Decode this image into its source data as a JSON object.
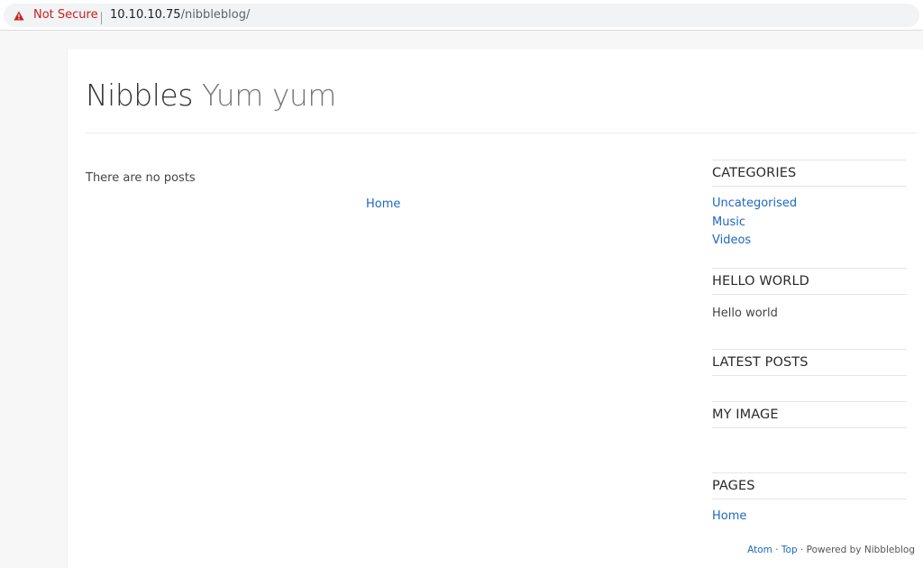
{
  "browser": {
    "security_label": "Not Secure",
    "url_host": "10.10.10.75",
    "url_path": "/nibbleblog/"
  },
  "header": {
    "name": "Nibbles",
    "slogan": "Yum yum"
  },
  "main": {
    "empty_message": "There are no posts",
    "pager_home": "Home"
  },
  "sidebar": {
    "categories": {
      "title": "CATEGORIES",
      "items": [
        "Uncategorised",
        "Music",
        "Videos"
      ]
    },
    "hello_world": {
      "title": "HELLO WORLD",
      "text": "Hello world"
    },
    "latest_posts": {
      "title": "LATEST POSTS"
    },
    "my_image": {
      "title": "MY IMAGE"
    },
    "pages": {
      "title": "PAGES",
      "items": [
        "Home"
      ]
    }
  },
  "footer": {
    "atom": "Atom",
    "sep1": " · ",
    "top": "Top",
    "powered": " · Powered by Nibbleblog"
  },
  "colors": {
    "link": "#1d68c0",
    "warning": "#c5221f"
  },
  "icons": {
    "security": "warning-triangle-icon"
  }
}
